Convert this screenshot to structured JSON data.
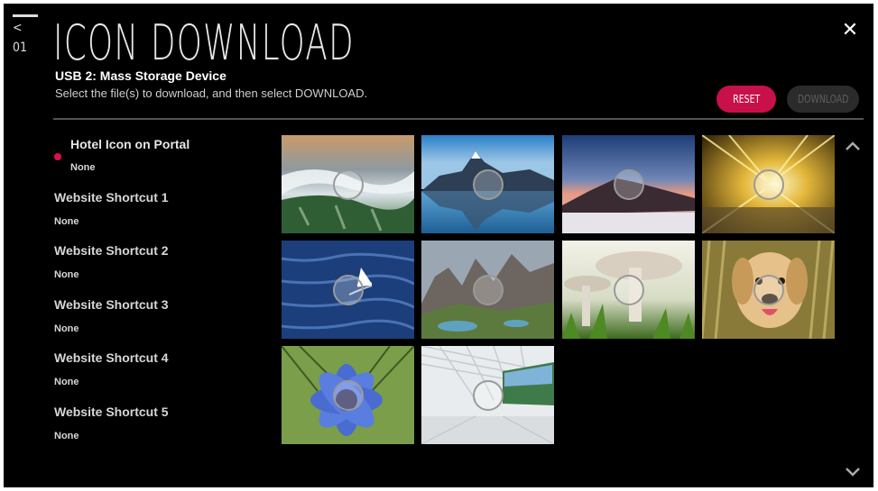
{
  "header": {
    "back_label": "< 01",
    "title": "ICON DOWNLOAD",
    "device": "USB 2: Mass Storage Device",
    "description": "Select the file(s) to download, and then select DOWNLOAD."
  },
  "buttons": {
    "reset": "RESET",
    "download": "DOWNLOAD"
  },
  "slots": [
    {
      "label": "Hotel Icon on Portal",
      "value": "None",
      "active": true
    },
    {
      "label": "Website Shortcut 1",
      "value": "None"
    },
    {
      "label": "Website Shortcut 2",
      "value": "None"
    },
    {
      "label": "Website Shortcut 3",
      "value": "None"
    },
    {
      "label": "Website Shortcut 4",
      "value": "None"
    },
    {
      "label": "Website Shortcut 5",
      "value": "None"
    }
  ],
  "images": [
    {
      "subject": "coastline-aerial"
    },
    {
      "subject": "mountain-lake"
    },
    {
      "subject": "volcano-sunrise"
    },
    {
      "subject": "golden-tunnel"
    },
    {
      "subject": "sailboat-ocean"
    },
    {
      "subject": "rocky-mountains"
    },
    {
      "subject": "mushrooms"
    },
    {
      "subject": "golden-retriever"
    },
    {
      "subject": "blue-flower"
    },
    {
      "subject": "airport-terminal"
    }
  ],
  "colors": {
    "accent": "#c8104a",
    "background": "#000000"
  }
}
